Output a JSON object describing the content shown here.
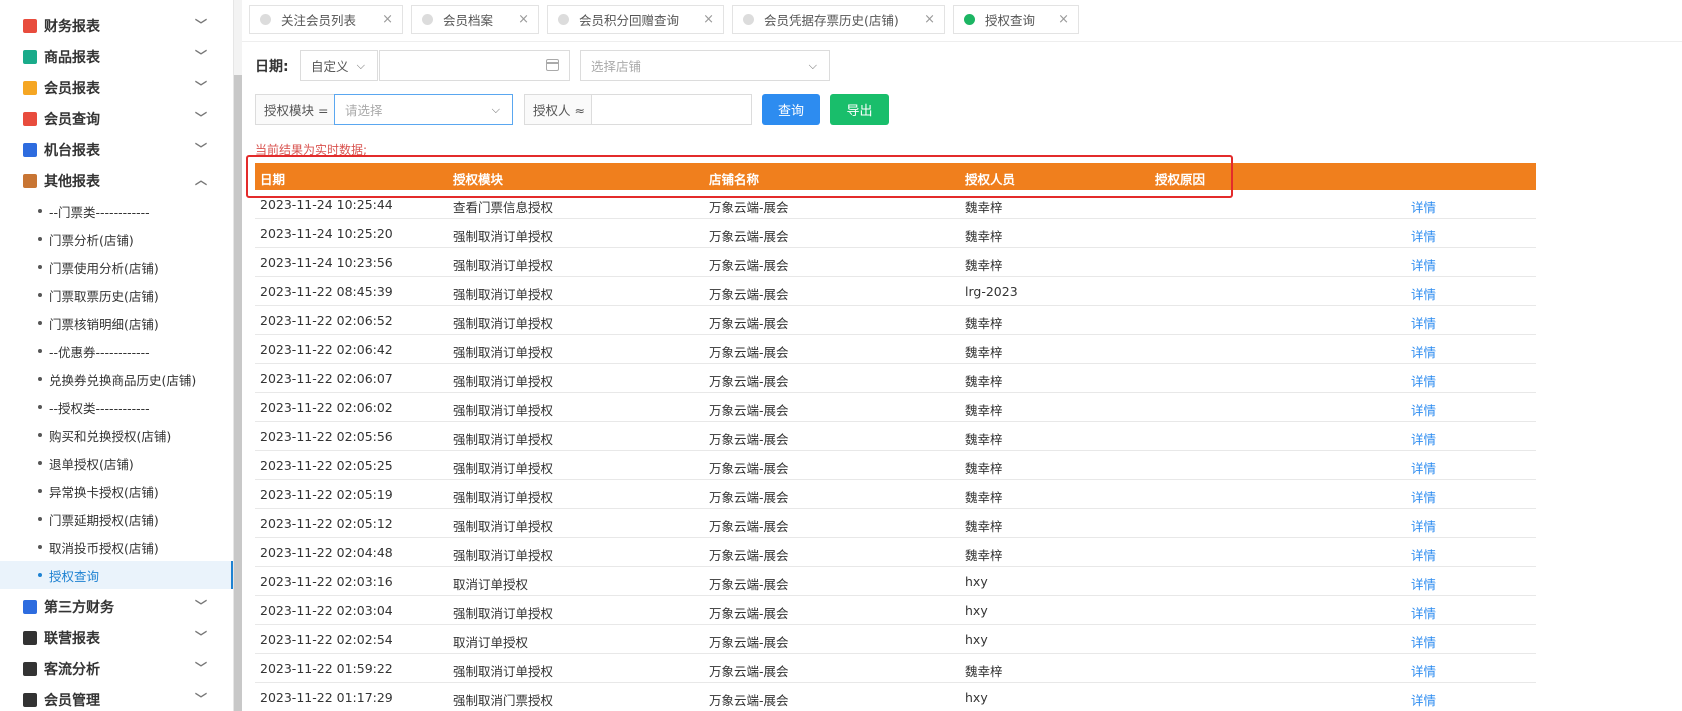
{
  "sidebar": {
    "groups": [
      {
        "label": "财务报表",
        "icon": "finance-report-icon",
        "color": "#e84c3d",
        "chevron": "down"
      },
      {
        "label": "商品报表",
        "icon": "goods-report-icon",
        "color": "#1aab8a",
        "chevron": "down"
      },
      {
        "label": "会员报表",
        "icon": "member-report-icon",
        "color": "#f5a623",
        "chevron": "down"
      },
      {
        "label": "会员查询",
        "icon": "member-query-icon",
        "color": "#e84c3d",
        "chevron": "down"
      },
      {
        "label": "机台报表",
        "icon": "machine-report-icon",
        "color": "#2d6cdf",
        "chevron": "down"
      },
      {
        "label": "其他报表",
        "icon": "other-report-icon",
        "color": "#c87533",
        "chevron": "up"
      }
    ],
    "sub_items": [
      "--门票类------------",
      "门票分析(店铺)",
      "门票使用分析(店铺)",
      "门票取票历史(店铺)",
      "门票核销明细(店铺)",
      "--优惠券------------",
      "兑换券兑换商品历史(店铺)",
      "--授权类------------",
      "购买和兑换授权(店铺)",
      "退单授权(店铺)",
      "异常换卡授权(店铺)",
      "门票延期授权(店铺)",
      "取消投币授权(店铺)",
      "授权查询"
    ],
    "active_sub": "授权查询",
    "groups_after": [
      {
        "label": "第三方财务",
        "icon": "third-party-finance-icon",
        "color": "#2d6cdf",
        "chevron": "down"
      },
      {
        "label": "联营报表",
        "icon": "joint-report-icon",
        "color": "#333333",
        "chevron": "down"
      },
      {
        "label": "客流分析",
        "icon": "traffic-analysis-icon",
        "color": "#333333",
        "chevron": "down"
      },
      {
        "label": "会员管理",
        "icon": "member-manage-icon",
        "color": "#333333",
        "chevron": "down"
      }
    ]
  },
  "tabs": [
    {
      "label": "关注会员列表",
      "active": false
    },
    {
      "label": "会员档案",
      "active": false
    },
    {
      "label": "会员积分回赠查询",
      "active": false
    },
    {
      "label": "会员凭据存票历史(店铺)",
      "active": false
    },
    {
      "label": "授权查询",
      "active": true
    }
  ],
  "filters": {
    "date_label": "日期:",
    "date_mode": "自定义",
    "date_value": "",
    "store_placeholder": "选择店铺",
    "module_prefix": "授权模块 =",
    "module_placeholder": "请选择",
    "person_prefix": "授权人 ≈",
    "person_value": "",
    "query_button": "查询",
    "export_button": "导出"
  },
  "notice": "当前结果为实时数据;",
  "table": {
    "columns": [
      "日期",
      "授权模块",
      "店铺名称",
      "授权人员",
      "授权原因",
      ""
    ],
    "detail_label": "详情",
    "rows": [
      [
        "2023-11-24 10:25:44",
        "查看门票信息授权",
        "万象云端-展会",
        "魏幸梓",
        ""
      ],
      [
        "2023-11-24 10:25:20",
        "强制取消订单授权",
        "万象云端-展会",
        "魏幸梓",
        ""
      ],
      [
        "2023-11-24 10:23:56",
        "强制取消订单授权",
        "万象云端-展会",
        "魏幸梓",
        ""
      ],
      [
        "2023-11-22 08:45:39",
        "强制取消订单授权",
        "万象云端-展会",
        "lrg-2023",
        ""
      ],
      [
        "2023-11-22 02:06:52",
        "强制取消订单授权",
        "万象云端-展会",
        "魏幸梓",
        ""
      ],
      [
        "2023-11-22 02:06:42",
        "强制取消订单授权",
        "万象云端-展会",
        "魏幸梓",
        ""
      ],
      [
        "2023-11-22 02:06:07",
        "强制取消订单授权",
        "万象云端-展会",
        "魏幸梓",
        ""
      ],
      [
        "2023-11-22 02:06:02",
        "强制取消订单授权",
        "万象云端-展会",
        "魏幸梓",
        ""
      ],
      [
        "2023-11-22 02:05:56",
        "强制取消订单授权",
        "万象云端-展会",
        "魏幸梓",
        ""
      ],
      [
        "2023-11-22 02:05:25",
        "强制取消订单授权",
        "万象云端-展会",
        "魏幸梓",
        ""
      ],
      [
        "2023-11-22 02:05:19",
        "强制取消订单授权",
        "万象云端-展会",
        "魏幸梓",
        ""
      ],
      [
        "2023-11-22 02:05:12",
        "强制取消订单授权",
        "万象云端-展会",
        "魏幸梓",
        ""
      ],
      [
        "2023-11-22 02:04:48",
        "强制取消订单授权",
        "万象云端-展会",
        "魏幸梓",
        ""
      ],
      [
        "2023-11-22 02:03:16",
        "取消订单授权",
        "万象云端-展会",
        "hxy",
        ""
      ],
      [
        "2023-11-22 02:03:04",
        "强制取消订单授权",
        "万象云端-展会",
        "hxy",
        ""
      ],
      [
        "2023-11-22 02:02:54",
        "取消订单授权",
        "万象云端-展会",
        "hxy",
        ""
      ],
      [
        "2023-11-22 01:59:22",
        "强制取消订单授权",
        "万象云端-展会",
        "魏幸梓",
        ""
      ],
      [
        "2023-11-22 01:17:29",
        "强制取消门票授权",
        "万象云端-展会",
        "hxy",
        ""
      ]
    ]
  },
  "colors": {
    "header_bg": "#f07f1d",
    "query_btn": "#2d8cf0",
    "export_btn": "#19be6b",
    "highlight_border": "#e32b2b",
    "active_tab_dot": "#1cb563"
  }
}
